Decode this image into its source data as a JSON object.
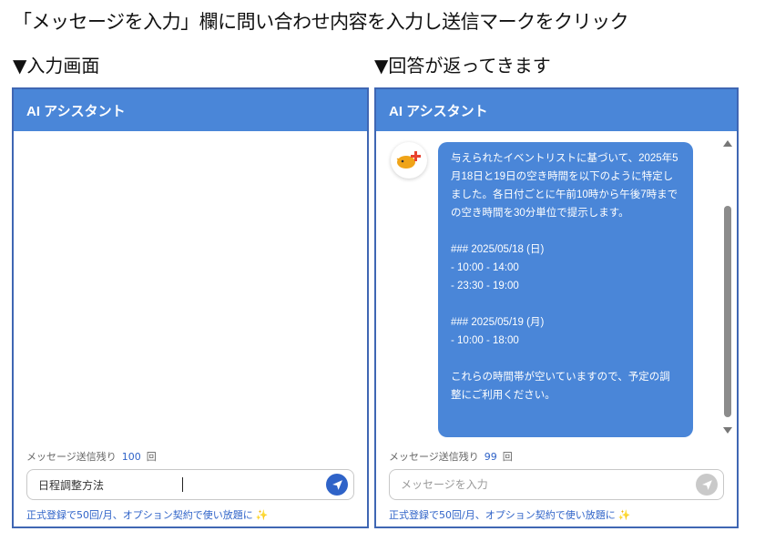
{
  "headline": "「メッセージを入力」欄に問い合わせ内容を入力し送信マークをクリック",
  "label_left": "▼入力画面",
  "label_right": "▼回答が返ってきます",
  "left_panel": {
    "title": "AI アシスタント",
    "quota_label": "メッセージ送信残り",
    "quota_count": "100",
    "quota_unit": "回",
    "input_value": "日程調整方法",
    "promo": "正式登録で50回/月、オプション契約で使い放題に"
  },
  "right_panel": {
    "title": "AI アシスタント",
    "message": "与えられたイベントリストに基づいて、2025年5月18日と19日の空き時間を以下のように特定しました。各日付ごとに午前10時から午後7時までの空き時間を30分単位で提示します。\n\n### 2025/05/18 (日)\n- 10:00 - 14:00\n- 23:30 - 19:00\n\n### 2025/05/19 (月)\n- 10:00 - 18:00\n\nこれらの時間帯が空いていますので、予定の調整にご利用ください。",
    "quota_label": "メッセージ送信残り",
    "quota_count": "99",
    "quota_unit": "回",
    "input_placeholder": "メッセージを入力",
    "promo": "正式登録で50回/月、オプション契約で使い放題に"
  },
  "colors": {
    "header": "#4a86d8",
    "border": "#3f66b3",
    "accent": "#2f63c8",
    "sparkle": "#f3c21b"
  },
  "icons": {
    "send": "paper-plane-icon",
    "avatar": "bot-avatar-icon",
    "sparkle": "sparkle-icon"
  }
}
